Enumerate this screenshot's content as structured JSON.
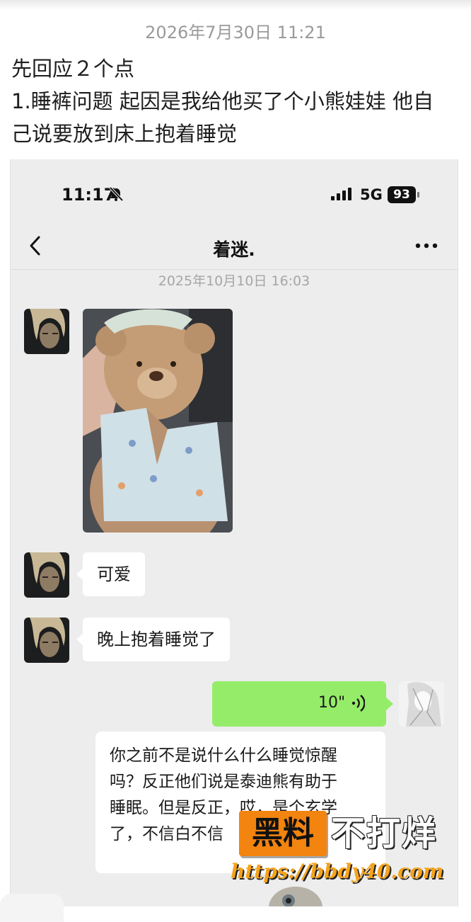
{
  "post": {
    "timestamp": "2026年7月30日 11:21",
    "lines": [
      "先回应２个点",
      "1.睡裤问题 起因是我给他买了个小熊娃娃 他自",
      "己说要放到床上抱着睡觉"
    ]
  },
  "screenshot": {
    "status_bar": {
      "time": "11:17",
      "network": "5G",
      "battery": "93"
    },
    "chat": {
      "title": "着迷.",
      "timestamp": "2025年10月10日 16:03",
      "messages": [
        {
          "type": "image",
          "description": "teddy bear in pajama shirt"
        },
        {
          "type": "text",
          "text": "可爱"
        },
        {
          "type": "text",
          "text": "晚上抱着睡觉了"
        },
        {
          "type": "voice",
          "duration": "10\""
        }
      ],
      "transcript_lines": [
        "你之前不是说什么什么睡觉惊醒",
        "吗？反正他们说是泰迪熊有助于",
        "睡眠。但是反正，哎，是个玄学",
        "了，不信白不信"
      ]
    }
  },
  "watermark": {
    "box_text": "黑料",
    "text": "不打烊",
    "url": "https://bbdy40.com"
  },
  "colors": {
    "chat_bg": "#ededed",
    "voice_bubble": "#95ec69",
    "watermark_orange": "#f2840f"
  }
}
